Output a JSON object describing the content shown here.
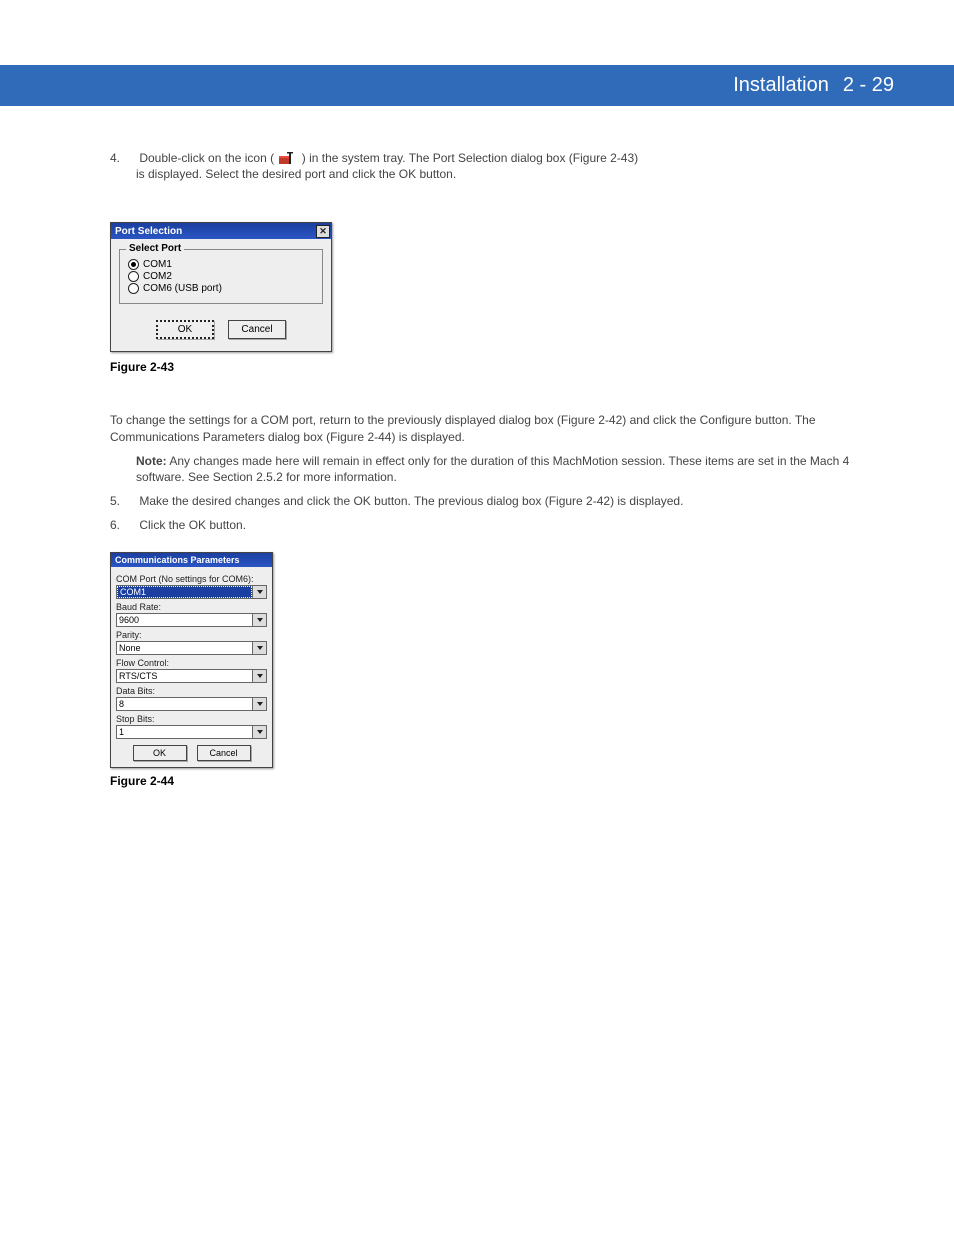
{
  "header": {
    "title_left": "Installation",
    "title_right": "2 - 29"
  },
  "intro": {
    "step_num": "4.",
    "line_a": "Double-click on the icon (",
    "line_b": ") in the system tray. The Port Selection dialog box (Figure 2-43)",
    "line_c": "is displayed. Select the desired port and click the OK button.",
    "icon_name": "port-selection-tray-icon"
  },
  "fig43": {
    "title": "Port Selection",
    "group_legend": "Select Port",
    "options": [
      {
        "label": "COM1",
        "selected": true
      },
      {
        "label": "COM2",
        "selected": false
      },
      {
        "label": "COM6 (USB port)",
        "selected": false
      }
    ],
    "ok": "OK",
    "cancel": "Cancel",
    "caption": "Figure 2-43"
  },
  "mid": {
    "p1": "To change the settings for a COM port, return to the previously displayed dialog box (Figure 2-42) and click the Configure button. The Communications Parameters dialog box (Figure 2-44) is displayed.",
    "note_label": "Note:",
    "note_text": "Any changes made here will remain in effect only for the duration of this MachMotion session. These items are set in the Mach 4 software. See Section 2.5.2 for more information.",
    "p2a_num": "5.",
    "p2a": "Make the desired changes and click the OK button. The previous dialog box (Figure 2-42) is displayed.",
    "p2b_num": "6.",
    "p2b": "Click the OK button."
  },
  "fig44": {
    "title": "Communications Parameters",
    "fields": {
      "comport_label": "COM Port (No settings for COM6):",
      "comport_value": "COM1",
      "baud_label": "Baud Rate:",
      "baud_value": "9600",
      "parity_label": "Parity:",
      "parity_value": "None",
      "flow_label": "Flow Control:",
      "flow_value": "RTS/CTS",
      "databits_label": "Data Bits:",
      "databits_value": "8",
      "stopbits_label": "Stop Bits:",
      "stopbits_value": "1"
    },
    "ok": "OK",
    "cancel": "Cancel",
    "caption": "Figure 2-44"
  }
}
